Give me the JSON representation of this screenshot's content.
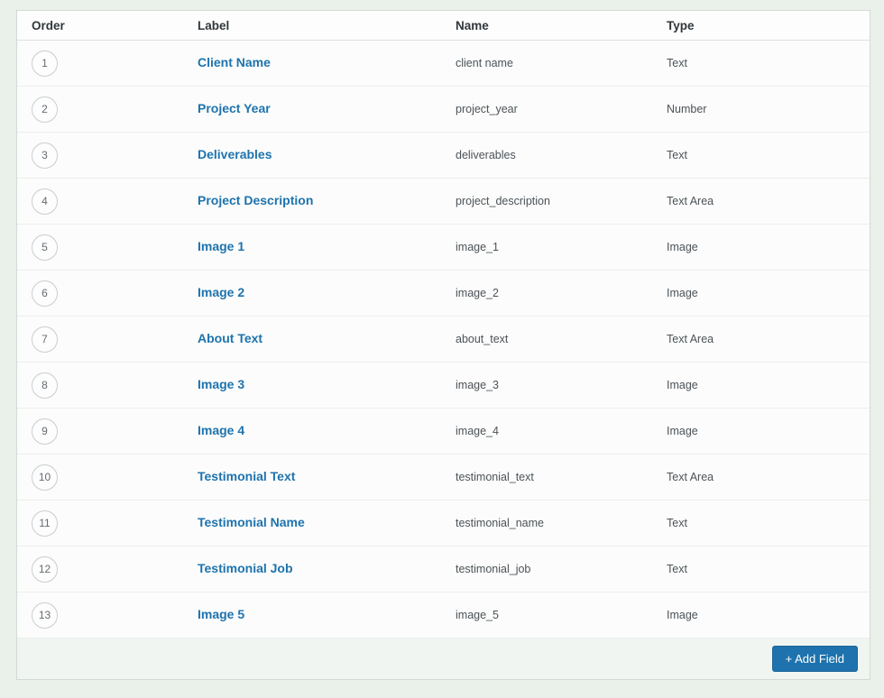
{
  "colors": {
    "page_background": "#e9f1ea",
    "accent_blue": "#1e73ae",
    "footer_background": "#f0f5f1"
  },
  "table": {
    "headers": [
      "Order",
      "Label",
      "Name",
      "Type"
    ],
    "rows": [
      {
        "order": "1",
        "label": "Client Name",
        "name": "client name",
        "type": "Text"
      },
      {
        "order": "2",
        "label": "Project Year",
        "name": "project_year",
        "type": "Number"
      },
      {
        "order": "3",
        "label": "Deliverables",
        "name": "deliverables",
        "type": "Text"
      },
      {
        "order": "4",
        "label": "Project Description",
        "name": "project_description",
        "type": "Text Area"
      },
      {
        "order": "5",
        "label": "Image 1",
        "name": "image_1",
        "type": "Image"
      },
      {
        "order": "6",
        "label": "Image 2",
        "name": "image_2",
        "type": "Image"
      },
      {
        "order": "7",
        "label": "About Text",
        "name": "about_text",
        "type": "Text Area"
      },
      {
        "order": "8",
        "label": "Image 3",
        "name": "image_3",
        "type": "Image"
      },
      {
        "order": "9",
        "label": "Image 4",
        "name": "image_4",
        "type": "Image"
      },
      {
        "order": "10",
        "label": "Testimonial Text",
        "name": "testimonial_text",
        "type": "Text Area"
      },
      {
        "order": "11",
        "label": "Testimonial Name",
        "name": "testimonial_name",
        "type": "Text"
      },
      {
        "order": "12",
        "label": "Testimonial Job",
        "name": "testimonial_job",
        "type": "Text"
      },
      {
        "order": "13",
        "label": "Image 5",
        "name": "image_5",
        "type": "Image"
      }
    ]
  },
  "footer": {
    "add_field_label": "+ Add Field"
  }
}
